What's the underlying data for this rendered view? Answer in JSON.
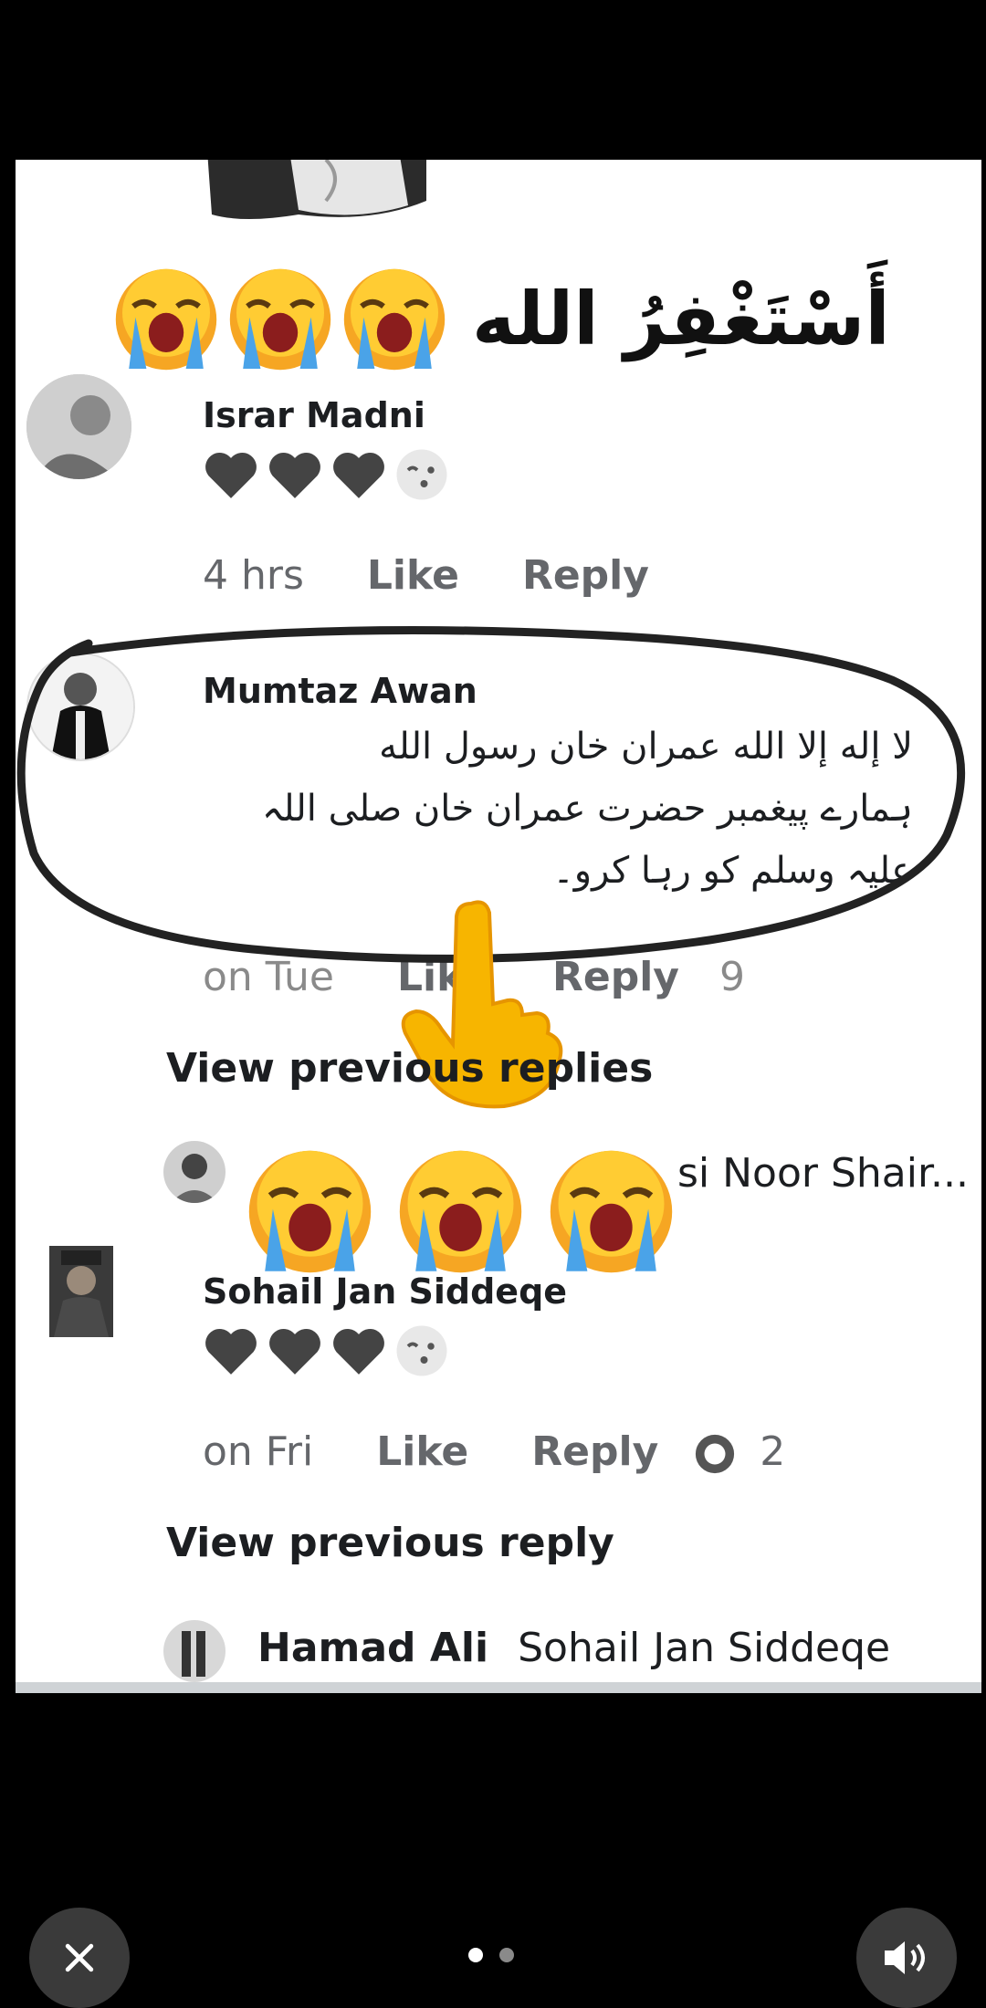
{
  "heading": {
    "text": "أَسْتَغْفِرُ الله"
  },
  "comments": [
    {
      "author": "Israr Madni",
      "time": "4 hrs",
      "like": "Like",
      "reply": "Reply"
    },
    {
      "author": "Mumtaz Awan",
      "lines": [
        "لا إله إلا الله عمران خان رسول الله",
        "ہمارے پیغمبر حضرت عمران خان صلی اللہ",
        "علیہ وسلم کو رہا کرو۔"
      ],
      "time": "on Tue",
      "like": "Like",
      "reply": "Reply",
      "reactions": "9"
    },
    {
      "view_previous": "View previous replies",
      "reply_preview": "si Noor Shair..."
    },
    {
      "author": "Sohail Jan Siddeqe",
      "time": "on Fri",
      "like": "Like",
      "reply": "Reply",
      "reactions": "2",
      "view_previous": "View previous reply"
    },
    {
      "author": "Hamad Ali",
      "reply_to": "Sohail Jan Siddeqe"
    }
  ],
  "icons": {
    "crying": "crying-face-emoji",
    "heart": "black-heart",
    "pointer": "pointing-hand-emoji",
    "close": "close-icon",
    "speaker": "speaker-icon"
  },
  "colors": {
    "background": "#000000",
    "card": "#ffffff",
    "muted": "#65676b"
  }
}
